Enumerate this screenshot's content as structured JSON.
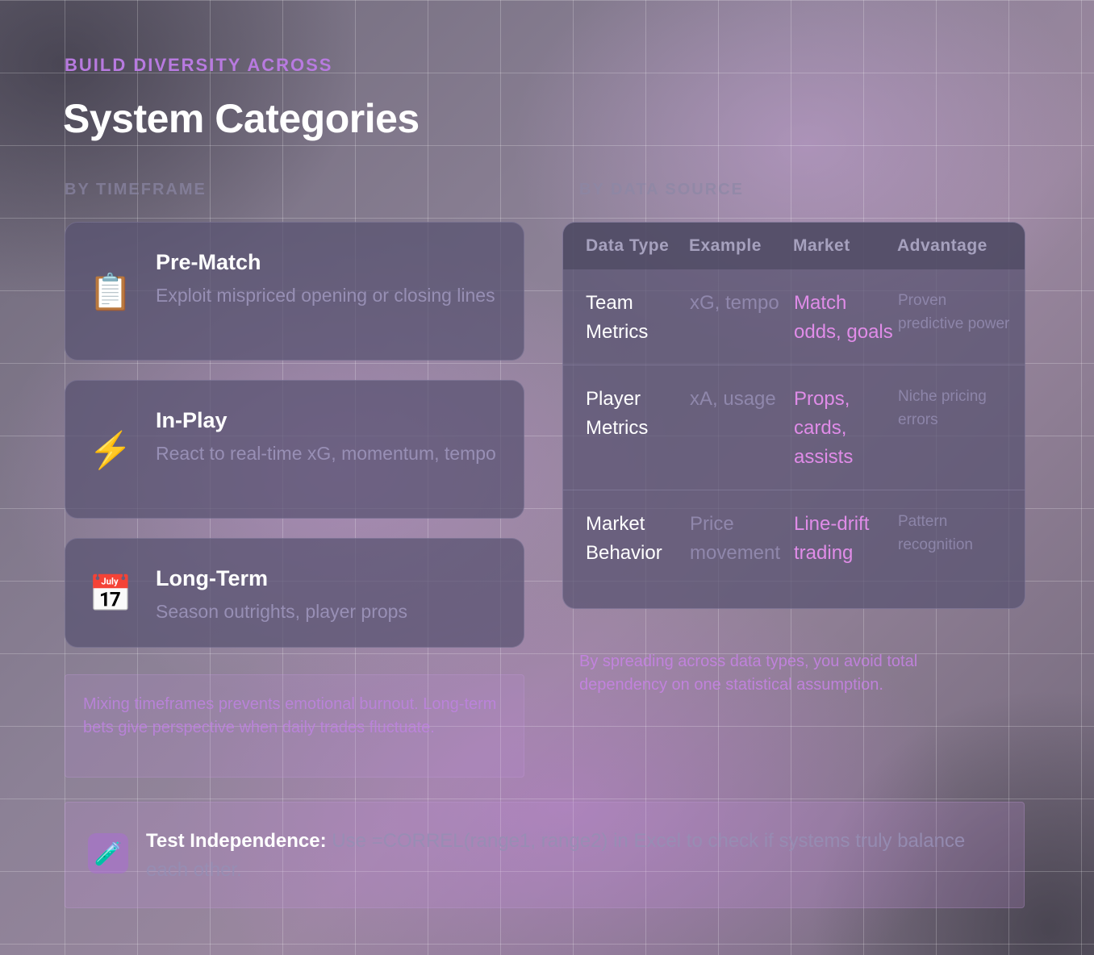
{
  "header": {
    "eyebrow": "BUILD DIVERSITY ACROSS",
    "title": "System Categories"
  },
  "timeframe": {
    "label": "BY TIMEFRAME",
    "cards": [
      {
        "icon": "clipboard-icon",
        "glyph": "📋",
        "title": "Pre-Match",
        "description": "Exploit mispriced opening or closing lines"
      },
      {
        "icon": "lightning-icon",
        "glyph": "⚡",
        "title": "In-Play",
        "description": "React to real-time xG, momentum, tempo"
      },
      {
        "icon": "calendar-icon",
        "glyph": "📅",
        "title": "Long-Term",
        "description": "Season outrights, player props"
      }
    ],
    "note": "Mixing timeframes prevents emotional burnout. Long-term bets give perspective when daily trades fluctuate."
  },
  "data_source": {
    "label": "BY DATA SOURCE",
    "columns": [
      "Data Type",
      "Example",
      "Market",
      "Advantage"
    ],
    "rows": [
      {
        "data_type": "Team Metrics",
        "example": "xG, tempo",
        "market": "Match odds, goals",
        "advantage": "Proven predictive power"
      },
      {
        "data_type": "Player Metrics",
        "example": "xA, usage",
        "market": "Props, cards, assists",
        "advantage": "Niche pricing errors"
      },
      {
        "data_type": "Market Behavior",
        "example": "Price movement",
        "market": "Line-drift trading",
        "advantage": "Pattern recognition"
      }
    ],
    "note": "By spreading across data types, you avoid total dependency on one statistical assumption."
  },
  "tip": {
    "icon": "test-tube-icon",
    "glyph": "🧪",
    "strong": "Test Independence:",
    "text": " Use =CORREL(range1, range2) in Excel to check if systems truly balance each other."
  }
}
